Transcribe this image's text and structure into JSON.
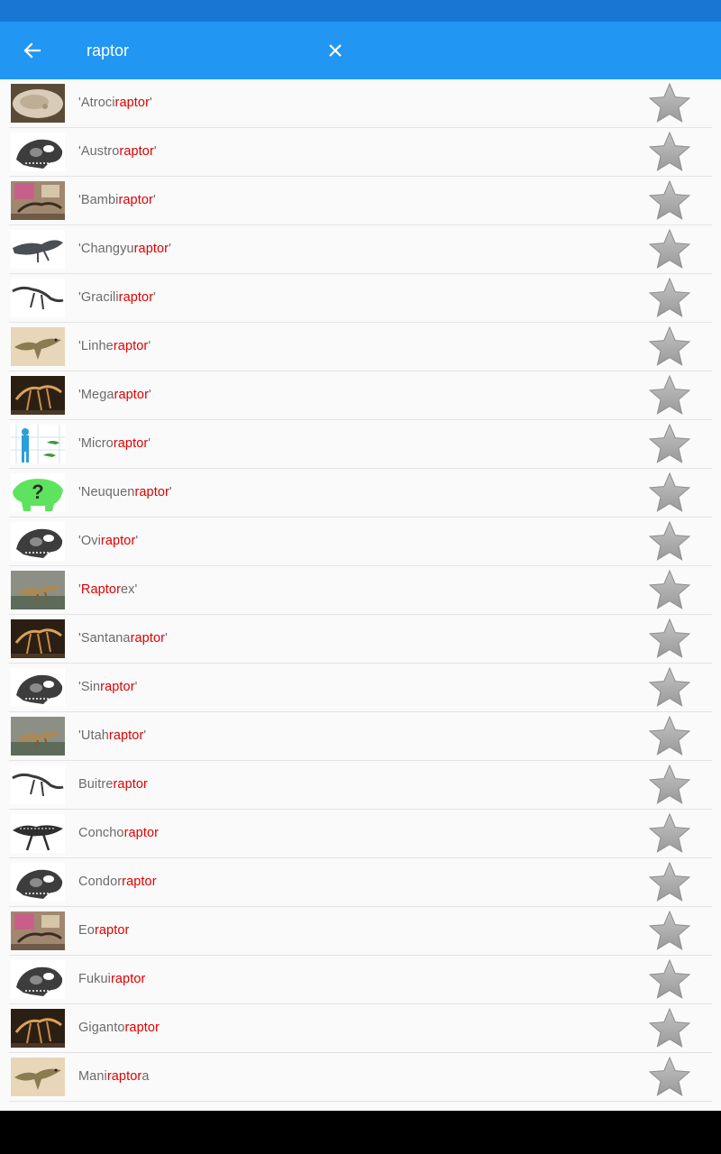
{
  "colors": {
    "status_bar": "#1976d2",
    "app_bar": "#2196f3",
    "highlight": "#e00000",
    "name_text": "#6b6b6b",
    "star": "#a8a8a8"
  },
  "search": {
    "value": "raptor",
    "back_icon": "arrow-left-icon",
    "clear_icon": "close-icon"
  },
  "results": [
    {
      "pre": "'Atroci",
      "hl": "raptor",
      "post": "'",
      "thumb": "fossil-photo"
    },
    {
      "pre": "'Austro",
      "hl": "raptor",
      "post": "'",
      "thumb": "skull-placeholder"
    },
    {
      "pre": "'Bambi",
      "hl": "raptor",
      "post": "'",
      "thumb": "museum-photo"
    },
    {
      "pre": "'Changyu",
      "hl": "raptor",
      "post": "'",
      "thumb": "feathered-fossil"
    },
    {
      "pre": "'Gracili",
      "hl": "raptor",
      "post": "'",
      "thumb": "skeleton-drawing"
    },
    {
      "pre": "'Linhe",
      "hl": "raptor",
      "post": "'",
      "thumb": "dinosaur-illustration"
    },
    {
      "pre": "'Mega",
      "hl": "raptor",
      "post": "'",
      "thumb": "mounted-skeleton"
    },
    {
      "pre": "'Micro",
      "hl": "raptor",
      "post": "'",
      "thumb": "size-comparison"
    },
    {
      "pre": "'Neuquen",
      "hl": "raptor",
      "post": "'",
      "thumb": "unknown-silhouette"
    },
    {
      "pre": "'Ovi",
      "hl": "raptor",
      "post": "'",
      "thumb": "skull-placeholder"
    },
    {
      "pre": "'",
      "hl": "Raptor",
      "post": "ex'",
      "thumb": "dinosaur-painting"
    },
    {
      "pre": "'Santana",
      "hl": "raptor",
      "post": "'",
      "thumb": "mounted-skeleton"
    },
    {
      "pre": "'Sin",
      "hl": "raptor",
      "post": "'",
      "thumb": "skull-placeholder"
    },
    {
      "pre": "'Utah",
      "hl": "raptor",
      "post": "'",
      "thumb": "dinosaur-painting"
    },
    {
      "pre": "Buitre",
      "hl": "raptor",
      "post": "",
      "thumb": "skeleton-drawing"
    },
    {
      "pre": "Concho",
      "hl": "raptor",
      "post": "",
      "thumb": "skeleton-diagram"
    },
    {
      "pre": "Condor",
      "hl": "raptor",
      "post": "",
      "thumb": "skull-placeholder"
    },
    {
      "pre": "Eo",
      "hl": "raptor",
      "post": "",
      "thumb": "museum-photo"
    },
    {
      "pre": "Fukui",
      "hl": "raptor",
      "post": "",
      "thumb": "skull-placeholder"
    },
    {
      "pre": "Giganto",
      "hl": "raptor",
      "post": "",
      "thumb": "mounted-skeleton"
    },
    {
      "pre": "Mani",
      "hl": "raptor",
      "post": "a",
      "thumb": "dinosaur-illustration"
    }
  ],
  "favorite_icon": "star-icon"
}
